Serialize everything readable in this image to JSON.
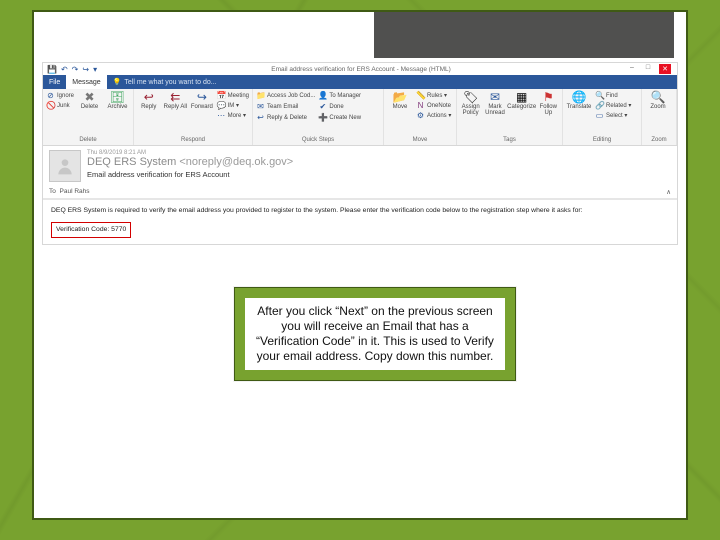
{
  "slide": {
    "instruction_text": "After you click “Next” on the previous screen you will receive an Email that has a “Verification Code” in it. This is used to Verify your email address. Copy down this number."
  },
  "window": {
    "title": "Email address verification for ERS Account - Message (HTML)",
    "minimize": "–",
    "maximize": "□",
    "close": "✕",
    "qat": {
      "save": "💾",
      "undo": "↶",
      "redo": "↷",
      "fwd": "↪",
      "down": "▾"
    }
  },
  "tabs": {
    "file": "File",
    "message": "Message",
    "tell_me": "Tell me what you want to do..."
  },
  "ribbon": {
    "delete": {
      "ignore": "Ignore",
      "junk": "Junk",
      "delete": "Delete",
      "archive": "Archive",
      "label": "Delete"
    },
    "respond": {
      "reply": "Reply",
      "reply_all": "Reply All",
      "forward": "Forward",
      "meeting": "Meeting",
      "im": "IM ▾",
      "more": "More ▾",
      "label": "Respond"
    },
    "quicksteps": {
      "a": "Access Job Cod...",
      "b": "Team Email",
      "c": "Reply & Delete",
      "d": "To Manager",
      "e": "Done",
      "f": "Create New",
      "label": "Quick Steps"
    },
    "move": {
      "move": "Move",
      "rules": "Rules ▾",
      "onenote": "OneNote",
      "actions": "Actions ▾",
      "label": "Move"
    },
    "tags": {
      "assign": "Assign Policy",
      "unread": "Mark Unread",
      "categorize": "Categorize",
      "followup": "Follow Up",
      "label": "Tags"
    },
    "editing": {
      "translate": "Translate",
      "find": "Find",
      "related": "Related ▾",
      "select": "Select ▾",
      "label": "Editing"
    },
    "zoom": {
      "zoom": "Zoom",
      "label": "Zoom"
    }
  },
  "message": {
    "received": "Thu 8/9/2019 8:21 AM",
    "from_name": "DEQ ERS System",
    "from_email": "<noreply@deq.ok.gov>",
    "subject": "Email address verification for ERS Account",
    "to_label": "To",
    "to_value": "Paul Rahs",
    "expand": "∧",
    "body_line1": "DEQ ERS System is required to verify the email address you provided to register to the system. Please enter the verification code below to the registration step where it asks for:",
    "verification_label": "Verification Code: 5770"
  }
}
